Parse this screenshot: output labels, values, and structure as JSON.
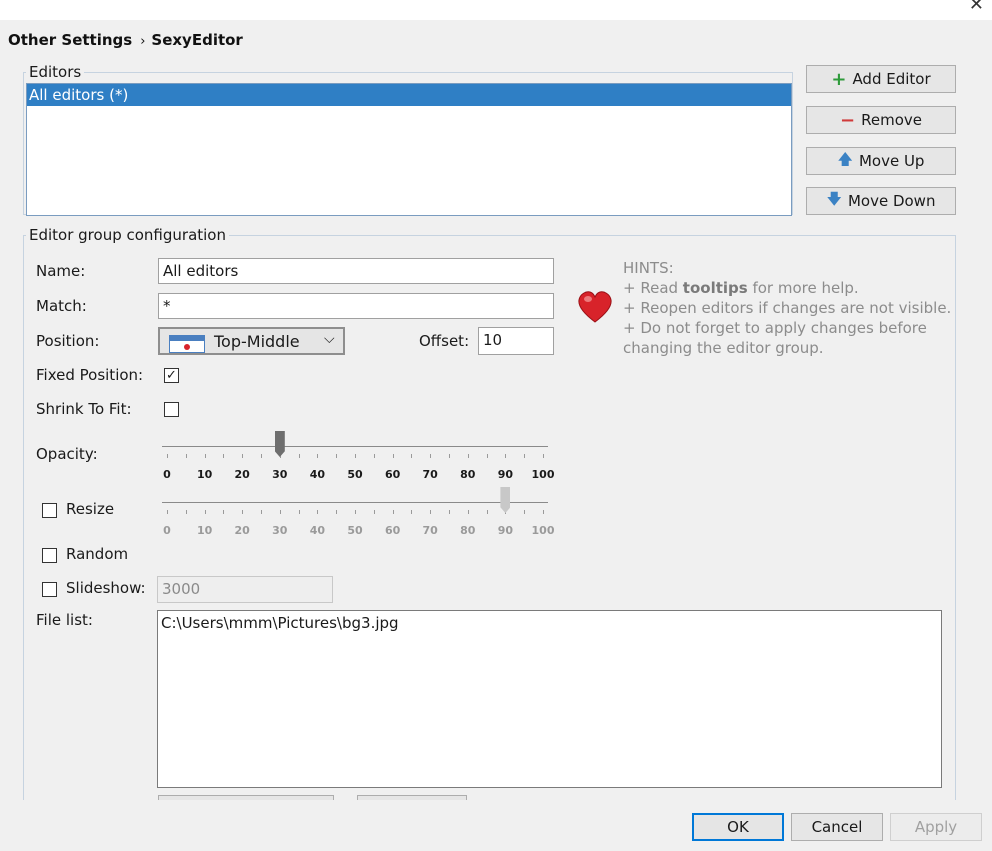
{
  "breadcrumb": {
    "parent": "Other Settings",
    "separator": "›",
    "current": "SexyEditor"
  },
  "editors": {
    "legend": "Editors",
    "items": [
      "All editors (*)"
    ],
    "selected_index": 0
  },
  "buttons": {
    "add_editor": "Add Editor",
    "remove": "Remove",
    "move_up": "Move Up",
    "move_down": "Move Down"
  },
  "config": {
    "legend": "Editor group configuration",
    "name_label": "Name:",
    "name_value": "All editors",
    "match_label": "Match:",
    "match_value": "*",
    "position_label": "Position:",
    "position_value": "Top-Middle",
    "offset_label": "Offset:",
    "offset_value": "10",
    "fixed_position_label": "Fixed Position:",
    "fixed_position_checked": true,
    "shrink_label": "Shrink To Fit:",
    "shrink_checked": false,
    "opacity_label": "Opacity:",
    "opacity_value": 30,
    "resize_label": "Resize",
    "resize_checked": false,
    "resize_value": 90,
    "random_label": "Random",
    "random_checked": false,
    "slideshow_label": "Slideshow:",
    "slideshow_checked": false,
    "slideshow_value": "3000",
    "filelist_label": "File list:",
    "filelist_value": "C:\\Users\\mmm\\Pictures\\bg3.jpg",
    "slider_ticks": [
      "0",
      "10",
      "20",
      "30",
      "40",
      "50",
      "60",
      "70",
      "80",
      "90",
      "100"
    ]
  },
  "hints": {
    "title": "HINTS:",
    "line1_pre": "+ Read ",
    "line1_bold": "tooltips",
    "line1_post": " for more help.",
    "line2": "+ Reopen editors if changes are not visible.",
    "line3": "+ Do not forget to apply changes before changing the editor group."
  },
  "dialog": {
    "ok": "OK",
    "cancel": "Cancel",
    "apply": "Apply"
  },
  "colors": {
    "selection": "#2f7fc5",
    "heart": "#d8232a",
    "add_icon": "#2e9b3a",
    "remove_icon": "#d03a3a",
    "arrow_icon": "#3b82c4"
  }
}
